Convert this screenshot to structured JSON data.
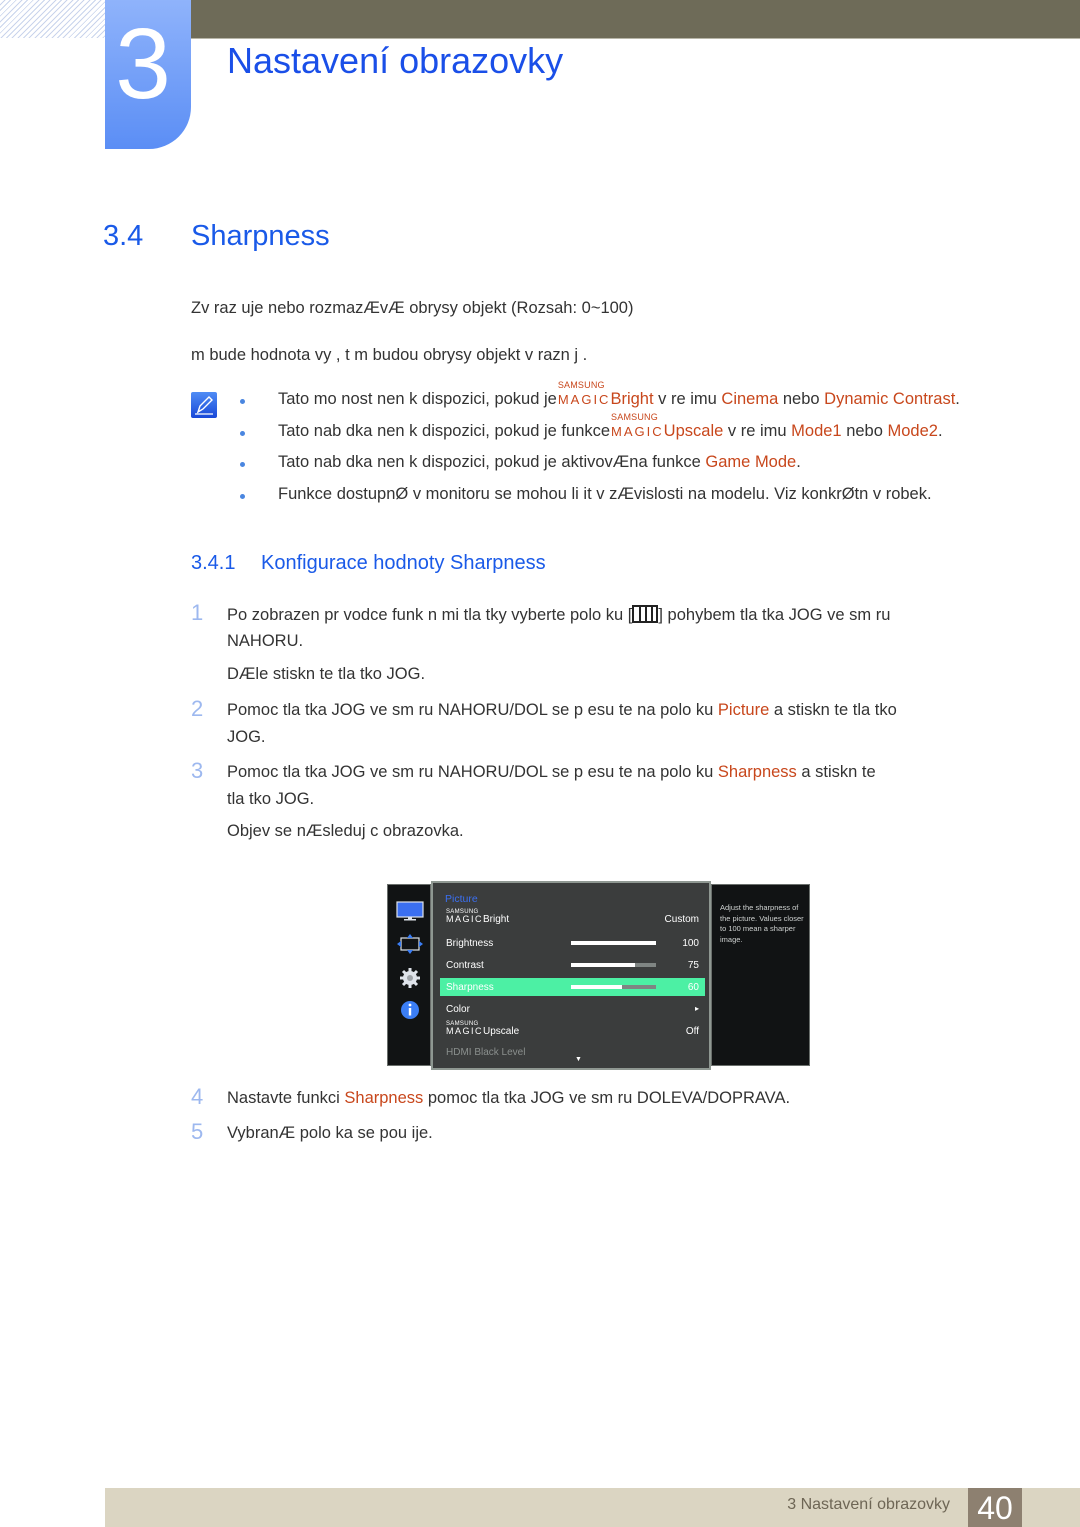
{
  "header": {
    "chapter_number": "3",
    "chapter_title": "Nastavení obrazovky"
  },
  "section": {
    "number": "3.4",
    "title": "Sharpness",
    "description": "Zv raz uje nebo rozmazÆvÆ obrysy objekt  (Rozsah: 0~100)",
    "description2": "m bude hodnota vy  , t m budou obrysy objekt  v razn j  ."
  },
  "notes": [
    {
      "pre": "Tato mo nost nen  k dispozici, pokud je",
      "magic_top": "SAMSUNG",
      "magic_bottom": "MAGIC",
      "hl1": "Bright",
      "mid1": " v re imu ",
      "hl2": "Cinema",
      "mid2": " nebo ",
      "hl3": "Dynamic Contrast",
      "post": "."
    },
    {
      "pre": "Tato nab dka nen  k dispozici, pokud je funkce",
      "magic_top": "SAMSUNG",
      "magic_bottom": "MAGIC",
      "hl1": "Upscale",
      "mid1": " v re imu ",
      "hl2": "Mode1",
      "mid2": " nebo ",
      "hl3": "Mode2",
      "post": "."
    },
    {
      "pre": "Tato nab dka nen  k dispozici, pokud je aktivovÆna funkce ",
      "hl1": "Game Mode",
      "post": "."
    },
    {
      "pre": "Funkce dostupnØ v monitoru se mohou li it v zÆvislosti na modelu. Viz konkrØtn  v robek."
    }
  ],
  "subsection": {
    "number": "3.4.1",
    "title": "Konfigurace hodnoty Sharpness"
  },
  "steps": [
    {
      "num": "1",
      "line1_pre": "Po zobrazen  pr vodce funk n mi tla  tky vyberte polo ku [",
      "line1_post": "] pohybem tla  tka JOG ve sm ru",
      "line2": "NAHORU.",
      "line3": "DÆle stiskn te tla  tko JOG."
    },
    {
      "num": "2",
      "line1_pre": "Pomoc  tla  tka JOG ve sm ru NAHORU/DOL  se p esu te na polo ku  ",
      "hl": "Picture",
      "line1_post": " a stiskn te tla  tko",
      "line2": "JOG."
    },
    {
      "num": "3",
      "line1_pre": "Pomoc  tla  tka JOG ve sm ru NAHORU/DOL  se p esu te na polo ku  ",
      "hl": "Sharpness",
      "line1_post": " a stiskn te",
      "line2": "tla  tko JOG.",
      "line3": "Objev  se nÆsleduj c  obrazovka."
    },
    {
      "num": "4",
      "line1_pre": "Nastavte funkci ",
      "hl": "Sharpness",
      "line1_post": " pomoc  tla  tka JOG ve sm ru DOLEVA/DOPRAVA."
    },
    {
      "num": "5",
      "line1_pre": "VybranÆ polo ka se pou ije."
    }
  ],
  "osd": {
    "sidebar_icons": [
      "monitor-icon",
      "size-position-icon",
      "gear-icon",
      "info-icon"
    ],
    "heading": "Picture",
    "rows": [
      {
        "magic_top": "SAMSUNG",
        "magic_bottom": "MAGIC",
        "label": "Bright",
        "value": "Custom"
      },
      {
        "label": "Brightness",
        "value": "100",
        "level": 100
      },
      {
        "label": "Contrast",
        "value": "75",
        "level": 75
      },
      {
        "label": "Sharpness",
        "value": "60",
        "level": 60,
        "selected": true
      },
      {
        "label": "Color",
        "value": "▸"
      },
      {
        "magic_top": "SAMSUNG",
        "magic_bottom": "MAGIC",
        "label": "Upscale",
        "value": "Off"
      },
      {
        "label": "HDMI Black Level",
        "disabled": true
      }
    ],
    "scroll_down": "▼",
    "help_text": "Adjust the sharpness of the picture. Values closer to 100 mean a sharper image."
  },
  "footer": {
    "chapter_label": "3 Nastavení obrazovky",
    "page_number": "40"
  },
  "colors": {
    "heading_blue": "#1a5ae8",
    "highlight_orange": "#c8471c",
    "osd_selected": "#4cf0a4",
    "footer_bg": "#dbd5c2",
    "page_box": "#8d8070"
  }
}
